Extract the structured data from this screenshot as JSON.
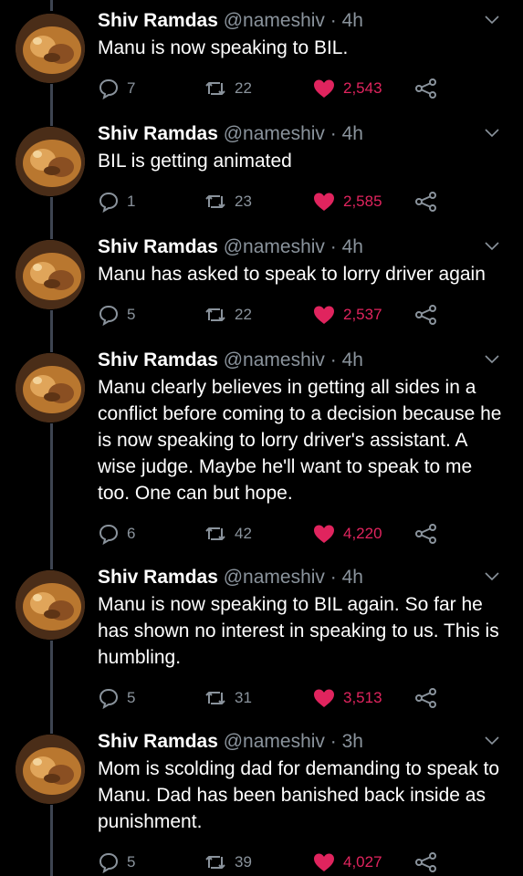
{
  "tweets": [
    {
      "name": "Shiv Ramdas",
      "handle": "@nameshiv",
      "time": "4h",
      "text": "Manu is now speaking to BIL.",
      "replies": "7",
      "retweets": "22",
      "likes": "2,543"
    },
    {
      "name": "Shiv Ramdas",
      "handle": "@nameshiv",
      "time": "4h",
      "text": "BIL is getting animated",
      "replies": "1",
      "retweets": "23",
      "likes": "2,585"
    },
    {
      "name": "Shiv Ramdas",
      "handle": "@nameshiv",
      "time": "4h",
      "text": "Manu has asked to speak to lorry driver again",
      "replies": "5",
      "retweets": "22",
      "likes": "2,537"
    },
    {
      "name": "Shiv Ramdas",
      "handle": "@nameshiv",
      "time": "4h",
      "text": "Manu clearly believes in getting all sides in a conflict before coming to a decision because he is now speaking to lorry driver's assistant. A wise judge. Maybe he'll want to speak to me too. One can but hope.",
      "replies": "6",
      "retweets": "42",
      "likes": "4,220"
    },
    {
      "name": "Shiv Ramdas",
      "handle": "@nameshiv",
      "time": "4h",
      "text": "Manu is now speaking to BIL again. So far he has shown no interest in speaking to us. This is humbling.",
      "replies": "5",
      "retweets": "31",
      "likes": "3,513"
    },
    {
      "name": "Shiv Ramdas",
      "handle": "@nameshiv",
      "time": "3h",
      "text": "Mom is scolding dad for demanding to speak to Manu. Dad has been banished back inside as punishment.",
      "replies": "5",
      "retweets": "39",
      "likes": "4,027"
    }
  ],
  "separator": "·",
  "colors": {
    "background": "#000000",
    "secondary_text": "#8a939c",
    "like": "#e0245e",
    "thread_line": "#3d4451"
  },
  "icons": {
    "reply": "reply-icon",
    "retweet": "retweet-icon",
    "like": "heart-icon",
    "share": "share-icon",
    "menu": "chevron-down-icon"
  }
}
